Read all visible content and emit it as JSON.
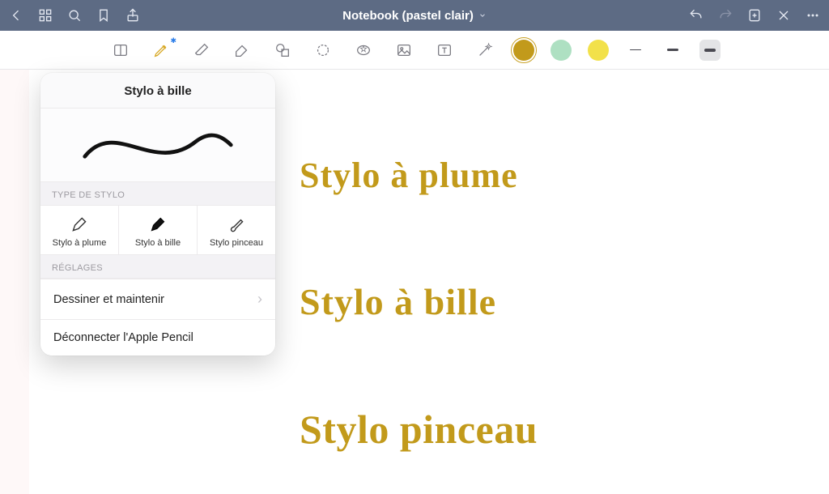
{
  "header": {
    "title": "Notebook (pastel clair)"
  },
  "popover": {
    "title": "Stylo à bille",
    "type_label": "TYPE DE STYLO",
    "pens": [
      {
        "label": "Stylo à plume"
      },
      {
        "label": "Stylo à bille"
      },
      {
        "label": "Stylo pinceau"
      }
    ],
    "settings_label": "RÉGLAGES",
    "rows": [
      {
        "label": "Dessiner et maintenir"
      },
      {
        "label": "Déconnecter l'Apple Pencil"
      }
    ]
  },
  "canvas": {
    "hw1": "Stylo à plume",
    "hw2": "Stylo à bille",
    "hw3": "Stylo pinceau"
  },
  "colors": {
    "selected": "#c29a1b",
    "c2": "#aee0c2",
    "c3": "#f2e14a"
  }
}
